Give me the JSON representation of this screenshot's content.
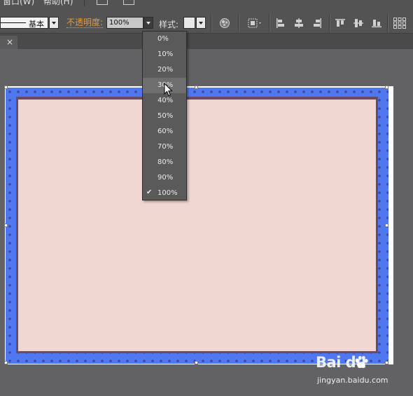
{
  "menubar": {
    "items": [
      "窗口(W)",
      "帮助(H)"
    ]
  },
  "controlbar": {
    "stroke_profile": "基本",
    "opacity_label": "不透明度:",
    "opacity_value": "100%",
    "style_label": "样式:"
  },
  "tab": {
    "close_label": "×"
  },
  "opacity_menu": {
    "options": [
      {
        "label": "0%",
        "checked": false,
        "highlighted": false
      },
      {
        "label": "10%",
        "checked": false,
        "highlighted": false
      },
      {
        "label": "20%",
        "checked": false,
        "highlighted": false
      },
      {
        "label": "30%",
        "checked": false,
        "highlighted": true
      },
      {
        "label": "40%",
        "checked": false,
        "highlighted": false
      },
      {
        "label": "50%",
        "checked": false,
        "highlighted": false
      },
      {
        "label": "60%",
        "checked": false,
        "highlighted": false
      },
      {
        "label": "70%",
        "checked": false,
        "highlighted": false
      },
      {
        "label": "80%",
        "checked": false,
        "highlighted": false
      },
      {
        "label": "90%",
        "checked": false,
        "highlighted": false
      },
      {
        "label": "100%",
        "checked": true,
        "highlighted": false
      }
    ],
    "check_glyph": "✔"
  },
  "canvas": {
    "frame_color": "#4f78f0",
    "photo_color": "#f1d7d2",
    "artboard_color": "#ffffff"
  },
  "watermark": {
    "logo": "Bai du",
    "url": "jingyan.baidu.com"
  },
  "colors": {
    "accent_label": "#e89a35",
    "ui_background": "#535353"
  }
}
